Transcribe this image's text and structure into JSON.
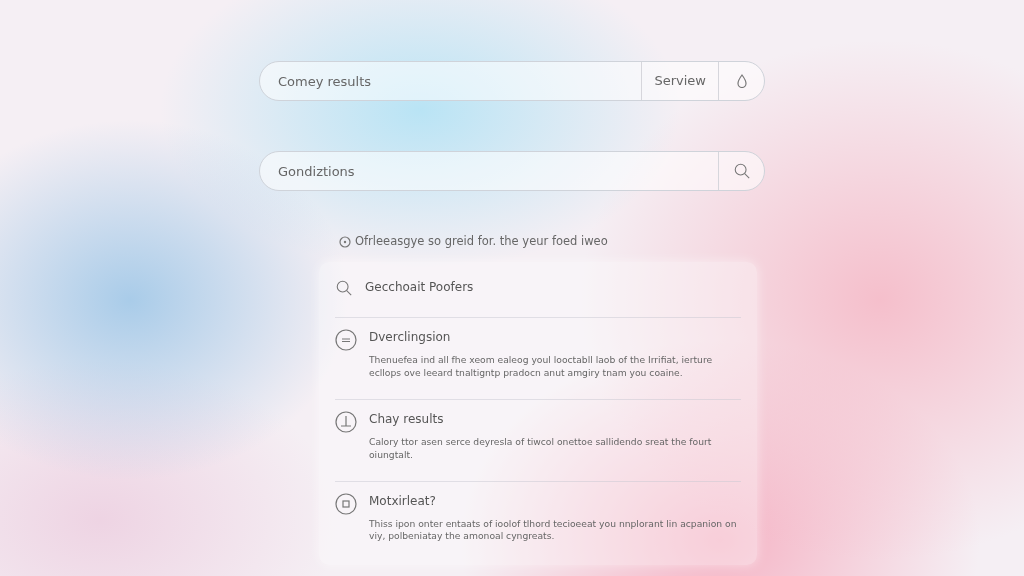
{
  "search_bars": [
    {
      "placeholder": "Comey results",
      "button": "Serview",
      "kind": "drop"
    },
    {
      "placeholder": "Gondiztions",
      "kind": "search"
    }
  ],
  "hint": "Ofrleeasgye so greid for. the yeur foed iweo",
  "suggestions": [
    {
      "kind": "search",
      "title": "Gecchoait Poofers"
    },
    {
      "kind": "lines",
      "title": "Dverclingsion",
      "description": "Thenuefea ind all fhe xeom ealeog youl looctabll laob of the Irrifiat, ierture ecllops ove leeard tnaltigntp pradocn anut amgiry tnam you coaine."
    },
    {
      "kind": "clock",
      "title": "Chay results",
      "description": "Calory ttor asen serce deyresla of tiwcol onettoe sallidendo sreat the fourt oiungtalt."
    },
    {
      "kind": "box",
      "title": "Motxirleat?",
      "description": "Thiss ipon onter entaats of ioolof tlhord tecioeeat you nnplorant lin acpanion on viy, polbeniatay the amonoal cyngreats."
    }
  ]
}
